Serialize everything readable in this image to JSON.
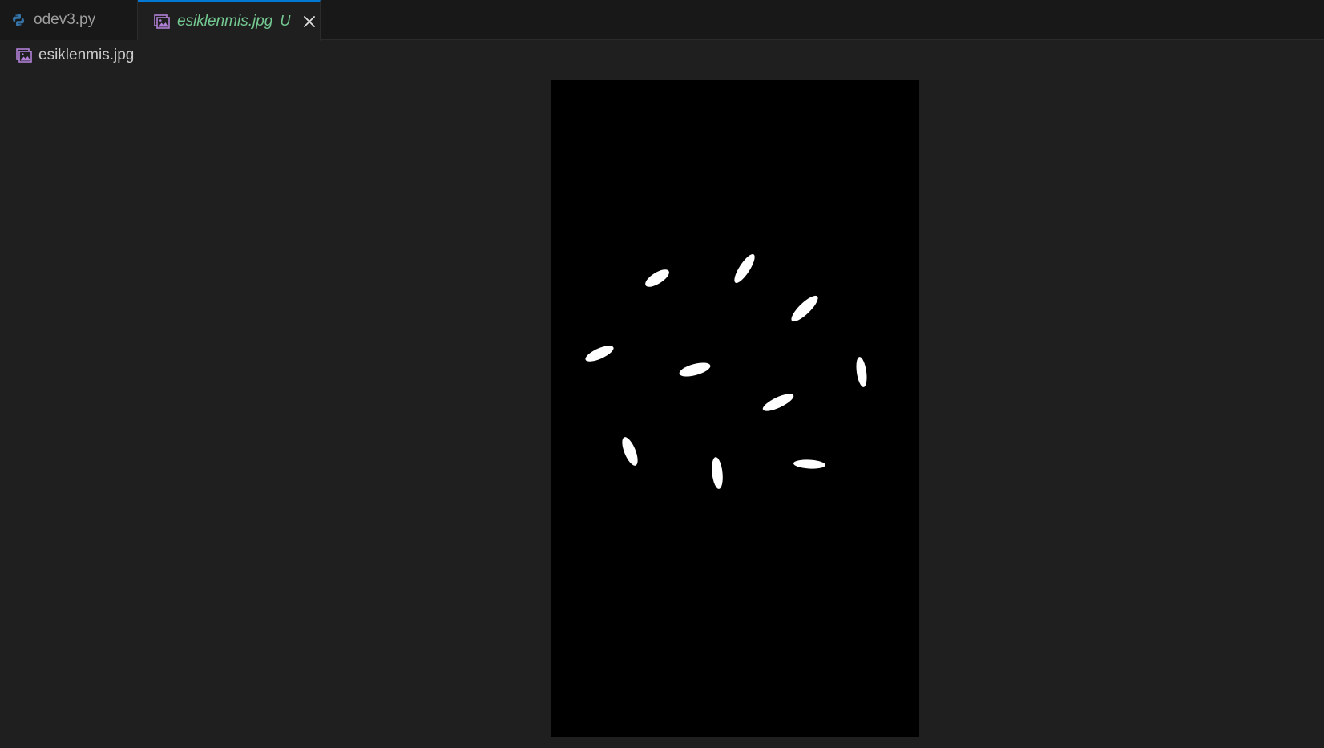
{
  "tabs": [
    {
      "label": "odev3.py",
      "icon": "python-icon",
      "active": false
    },
    {
      "label": "esiklenmis.jpg",
      "icon": "image-file-icon",
      "active": true,
      "status": "U"
    }
  ],
  "breadcrumb": {
    "label": "esiklenmis.jpg",
    "icon": "image-file-icon"
  },
  "colors": {
    "editor_bg": "#1f1f1f",
    "tabbar_bg": "#181818",
    "active_tab_border": "#0078d4",
    "untracked_green": "#73c991",
    "python_blue": "#3572a5",
    "image_icon_purple": "#b180d7",
    "image_bg": "#000000",
    "grain_color": "#ffffff"
  }
}
